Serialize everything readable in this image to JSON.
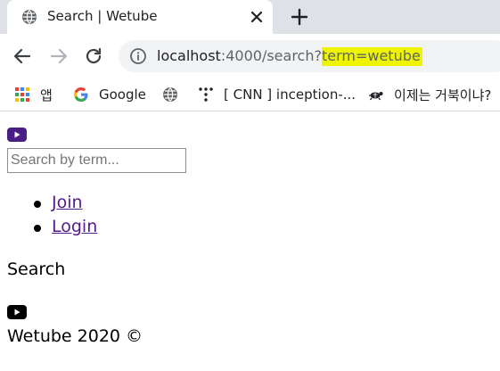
{
  "browser": {
    "tab": {
      "title": "Search | Wetube",
      "favicon": "globe-icon"
    },
    "new_tab_icon": "plus-icon",
    "toolbar": {
      "back_icon": "back-arrow-icon",
      "forward_icon": "forward-arrow-icon",
      "reload_icon": "reload-icon",
      "info_icon": "info-icon",
      "url_host": "localhost",
      "url_path": ":4000/search?",
      "url_query": "term=wetube",
      "highlight_color": "#eff500"
    },
    "bookmarks": [
      {
        "label": "앱",
        "icon": "apps-grid-icon"
      },
      {
        "label": "Google",
        "icon": "google-icon"
      },
      {
        "label": "",
        "icon": "globe-icon"
      },
      {
        "label": "[ CNN ] inception-...",
        "icon": "dots-icon"
      },
      {
        "label": "이제는 거북이냐?",
        "icon": "turtle-icon"
      }
    ]
  },
  "page": {
    "header_logo": "youtube-icon",
    "header_logo_color": "#4a1d87",
    "search": {
      "placeholder": "Search by term...",
      "value": ""
    },
    "nav": [
      {
        "label": "Join"
      },
      {
        "label": "Login"
      }
    ],
    "heading": "Search",
    "footer_logo": "youtube-icon",
    "footer_text": "Wetube 2020 ©"
  }
}
